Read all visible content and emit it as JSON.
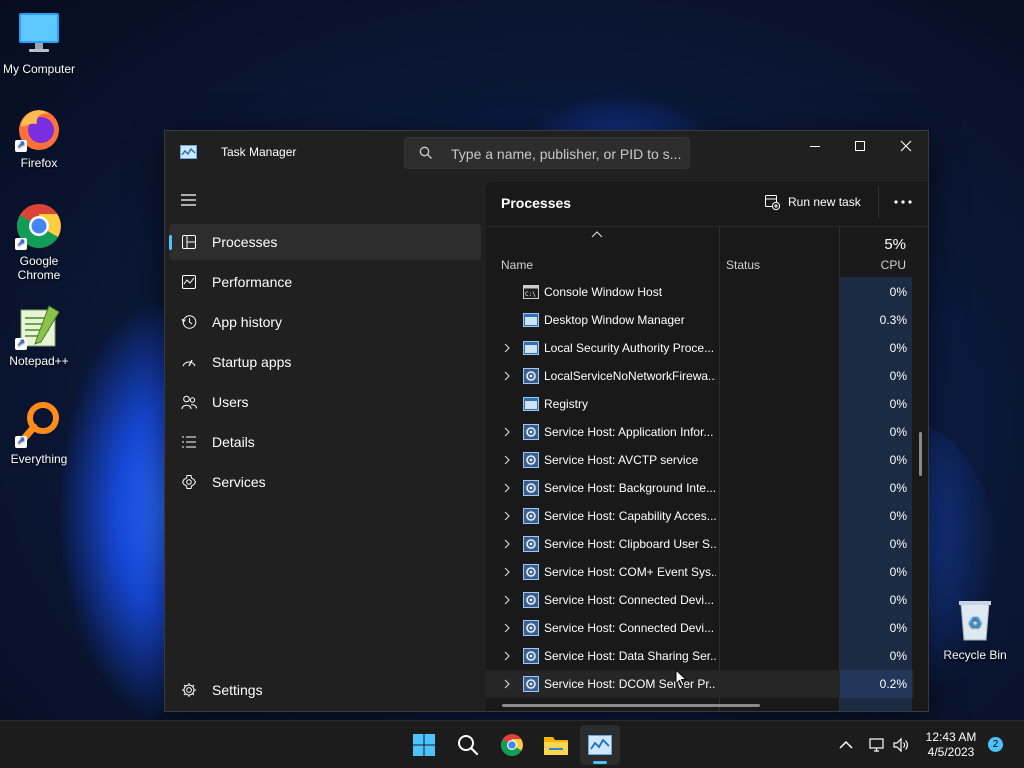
{
  "desktop": {
    "icons": [
      {
        "label": "My Computer",
        "icon": "monitor-icon"
      },
      {
        "label": "Firefox",
        "icon": "firefox-icon"
      },
      {
        "label": "Google Chrome",
        "icon": "chrome-icon"
      },
      {
        "label": "Notepad++",
        "icon": "notepadpp-icon"
      },
      {
        "label": "Everything",
        "icon": "everything-search-icon"
      },
      {
        "label": "Recycle Bin",
        "icon": "recycle-bin-icon"
      }
    ]
  },
  "window": {
    "title": "Task Manager",
    "search_placeholder": "Type a name, publisher, or PID to s..."
  },
  "sidebar": {
    "items": [
      {
        "label": "Processes",
        "icon": "processes-icon",
        "active": true
      },
      {
        "label": "Performance",
        "icon": "performance-icon"
      },
      {
        "label": "App history",
        "icon": "history-icon"
      },
      {
        "label": "Startup apps",
        "icon": "startup-icon"
      },
      {
        "label": "Users",
        "icon": "users-icon"
      },
      {
        "label": "Details",
        "icon": "details-icon"
      },
      {
        "label": "Services",
        "icon": "services-icon"
      }
    ],
    "settings_label": "Settings"
  },
  "main": {
    "title": "Processes",
    "run_new_task": "Run new task",
    "columns": {
      "name": "Name",
      "status": "Status",
      "cpu_percent": "5%",
      "cpu": "CPU"
    },
    "rows": [
      {
        "name": "Console Window Host",
        "cpu": "0%",
        "expandable": false,
        "icon": "console-icon"
      },
      {
        "name": "Desktop Window Manager",
        "cpu": "0.3%",
        "expandable": false,
        "icon": "window-app-icon"
      },
      {
        "name": "Local Security Authority Proce...",
        "cpu": "0%",
        "expandable": true,
        "icon": "window-app-icon"
      },
      {
        "name": "LocalServiceNoNetworkFirewa...",
        "cpu": "0%",
        "expandable": true,
        "icon": "service-gear-icon"
      },
      {
        "name": "Registry",
        "cpu": "0%",
        "expandable": false,
        "icon": "window-app-icon"
      },
      {
        "name": "Service Host: Application Infor...",
        "cpu": "0%",
        "expandable": true,
        "icon": "service-gear-icon"
      },
      {
        "name": "Service Host: AVCTP service",
        "cpu": "0%",
        "expandable": true,
        "icon": "service-gear-icon"
      },
      {
        "name": "Service Host: Background Inte...",
        "cpu": "0%",
        "expandable": true,
        "icon": "service-gear-icon"
      },
      {
        "name": "Service Host: Capability Acces...",
        "cpu": "0%",
        "expandable": true,
        "icon": "service-gear-icon"
      },
      {
        "name": "Service Host: Clipboard User S...",
        "cpu": "0%",
        "expandable": true,
        "icon": "service-gear-icon"
      },
      {
        "name": "Service Host: COM+ Event Sys...",
        "cpu": "0%",
        "expandable": true,
        "icon": "service-gear-icon"
      },
      {
        "name": "Service Host: Connected Devi...",
        "cpu": "0%",
        "expandable": true,
        "icon": "service-gear-icon"
      },
      {
        "name": "Service Host: Connected Devi...",
        "cpu": "0%",
        "expandable": true,
        "icon": "service-gear-icon"
      },
      {
        "name": "Service Host: Data Sharing Ser...",
        "cpu": "0%",
        "expandable": true,
        "icon": "service-gear-icon"
      },
      {
        "name": "Service Host: DCOM Server Pr...",
        "cpu": "0.2%",
        "expandable": true,
        "icon": "service-gear-icon",
        "hovered": true
      }
    ]
  },
  "taskbar": {
    "apps": [
      "start-icon",
      "search-icon",
      "chrome-icon",
      "file-explorer-icon",
      "task-manager-icon"
    ],
    "time": "12:43 AM",
    "date": "4/5/2023",
    "notification_count": "2"
  },
  "colors": {
    "accent": "#4cc2ff",
    "cpu_column": "#1b2b44",
    "window_bg": "#202020"
  }
}
